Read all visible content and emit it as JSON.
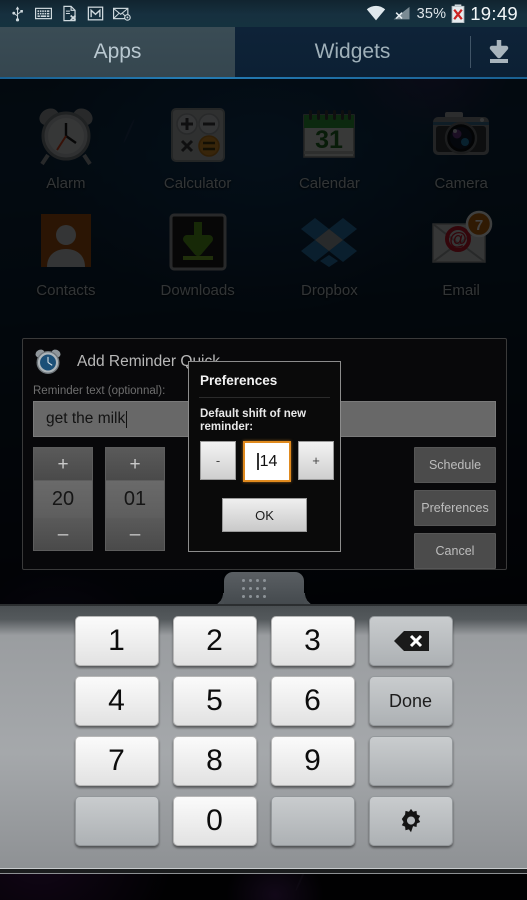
{
  "status_bar": {
    "icons": [
      "usb-icon",
      "keyboard-icon",
      "file-error-icon",
      "gmail-icon",
      "mail-sync-icon"
    ],
    "wifi_icon": "wifi-icon",
    "signal_icon": "signal-no-service-icon",
    "battery_percent": "35%",
    "battery_icon": "battery-error-icon",
    "time": "19:49"
  },
  "tabs": {
    "apps_label": "Apps",
    "widgets_label": "Widgets",
    "download_icon": "download-icon",
    "selected": "Apps"
  },
  "apps": [
    {
      "label": "Alarm",
      "icon": "alarm-clock-icon"
    },
    {
      "label": "Calculator",
      "icon": "calculator-icon"
    },
    {
      "label": "Calendar",
      "icon": "calendar-icon",
      "day": "31"
    },
    {
      "label": "Camera",
      "icon": "camera-icon"
    },
    {
      "label": "Contacts",
      "icon": "contacts-icon"
    },
    {
      "label": "Downloads",
      "icon": "downloads-icon"
    },
    {
      "label": "Dropbox",
      "icon": "dropbox-icon"
    },
    {
      "label": "Email",
      "icon": "email-icon",
      "badge": "7"
    }
  ],
  "reminder_dialog": {
    "app_icon": "alarm-clock-icon",
    "title": "Add Reminder Quick",
    "field_label": "Reminder text (optionnal):",
    "field_value": "get the milk",
    "steppers": [
      {
        "name": "hours",
        "plus": "+",
        "value": "20",
        "minus": "–"
      },
      {
        "name": "minutes",
        "plus": "+",
        "value": "01",
        "minus": "–"
      }
    ],
    "buttons": [
      "Schedule",
      "Preferences",
      "Cancel"
    ]
  },
  "preferences_dialog": {
    "title": "Preferences",
    "label": "Default shift of new reminder:",
    "decrement": "-",
    "value": "14",
    "increment": "+",
    "ok": "OK",
    "focus_color": "#e08a1e"
  },
  "keyboard": {
    "handle_icon": "drag-handle-dots-icon",
    "rows": [
      [
        {
          "t": "1",
          "k": "num"
        },
        {
          "t": "2",
          "k": "num"
        },
        {
          "t": "3",
          "k": "num"
        },
        {
          "t": "",
          "k": "fn",
          "icon": "backspace-icon"
        }
      ],
      [
        {
          "t": "4",
          "k": "num"
        },
        {
          "t": "5",
          "k": "num"
        },
        {
          "t": "6",
          "k": "num"
        },
        {
          "t": "Done",
          "k": "fn"
        }
      ],
      [
        {
          "t": "7",
          "k": "num"
        },
        {
          "t": "8",
          "k": "num"
        },
        {
          "t": "9",
          "k": "num"
        },
        {
          "t": "",
          "k": "blank"
        }
      ],
      [
        {
          "t": "",
          "k": "blank"
        },
        {
          "t": "0",
          "k": "num"
        },
        {
          "t": "",
          "k": "blank"
        },
        {
          "t": "",
          "k": "fn",
          "icon": "gear-icon"
        }
      ]
    ]
  },
  "colors": {
    "accent_blue": "#2a8fd0",
    "focus_orange": "#e08a1e",
    "tab_selected": "#3a4c55"
  }
}
